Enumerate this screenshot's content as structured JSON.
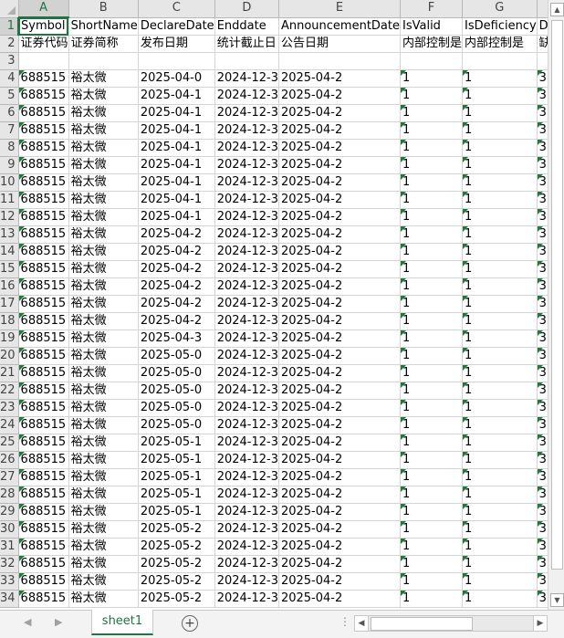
{
  "columns": [
    "A",
    "B",
    "C",
    "D",
    "E",
    "F",
    "G",
    "H"
  ],
  "header_row": [
    "Symbol",
    "ShortName",
    "DeclareDate",
    "Enddate",
    "AnnouncementDate",
    "IsValid",
    "IsDeficiency",
    "Deficiency"
  ],
  "cn_row": [
    "证券代码",
    "证券简称",
    "发布日期",
    "统计截止日",
    "公告日期",
    "内部控制是",
    "内部控制是",
    "缺陷类型"
  ],
  "data_rows": [
    [
      "688515",
      "裕太微",
      "2025-04-0",
      "2024-12-3",
      "2025-04-2",
      "1",
      "1",
      "3"
    ],
    [
      "688515",
      "裕太微",
      "2025-04-1",
      "2024-12-3",
      "2025-04-2",
      "1",
      "1",
      "3"
    ],
    [
      "688515",
      "裕太微",
      "2025-04-1",
      "2024-12-3",
      "2025-04-2",
      "1",
      "1",
      "3"
    ],
    [
      "688515",
      "裕太微",
      "2025-04-1",
      "2024-12-3",
      "2025-04-2",
      "1",
      "1",
      "3"
    ],
    [
      "688515",
      "裕太微",
      "2025-04-1",
      "2024-12-3",
      "2025-04-2",
      "1",
      "1",
      "3"
    ],
    [
      "688515",
      "裕太微",
      "2025-04-1",
      "2024-12-3",
      "2025-04-2",
      "1",
      "1",
      "3"
    ],
    [
      "688515",
      "裕太微",
      "2025-04-1",
      "2024-12-3",
      "2025-04-2",
      "1",
      "1",
      "3"
    ],
    [
      "688515",
      "裕太微",
      "2025-04-1",
      "2024-12-3",
      "2025-04-2",
      "1",
      "1",
      "3"
    ],
    [
      "688515",
      "裕太微",
      "2025-04-1",
      "2024-12-3",
      "2025-04-2",
      "1",
      "1",
      "3"
    ],
    [
      "688515",
      "裕太微",
      "2025-04-2",
      "2024-12-3",
      "2025-04-2",
      "1",
      "1",
      "3"
    ],
    [
      "688515",
      "裕太微",
      "2025-04-2",
      "2024-12-3",
      "2025-04-2",
      "1",
      "1",
      "3"
    ],
    [
      "688515",
      "裕太微",
      "2025-04-2",
      "2024-12-3",
      "2025-04-2",
      "1",
      "1",
      "3"
    ],
    [
      "688515",
      "裕太微",
      "2025-04-2",
      "2024-12-3",
      "2025-04-2",
      "1",
      "1",
      "3"
    ],
    [
      "688515",
      "裕太微",
      "2025-04-2",
      "2024-12-3",
      "2025-04-2",
      "1",
      "1",
      "3"
    ],
    [
      "688515",
      "裕太微",
      "2025-04-2",
      "2024-12-3",
      "2025-04-2",
      "1",
      "1",
      "3"
    ],
    [
      "688515",
      "裕太微",
      "2025-04-3",
      "2024-12-3",
      "2025-04-2",
      "1",
      "1",
      "3"
    ],
    [
      "688515",
      "裕太微",
      "2025-05-0",
      "2024-12-3",
      "2025-04-2",
      "1",
      "1",
      "3"
    ],
    [
      "688515",
      "裕太微",
      "2025-05-0",
      "2024-12-3",
      "2025-04-2",
      "1",
      "1",
      "3"
    ],
    [
      "688515",
      "裕太微",
      "2025-05-0",
      "2024-12-3",
      "2025-04-2",
      "1",
      "1",
      "3"
    ],
    [
      "688515",
      "裕太微",
      "2025-05-0",
      "2024-12-3",
      "2025-04-2",
      "1",
      "1",
      "3"
    ],
    [
      "688515",
      "裕太微",
      "2025-05-0",
      "2024-12-3",
      "2025-04-2",
      "1",
      "1",
      "3"
    ],
    [
      "688515",
      "裕太微",
      "2025-05-1",
      "2024-12-3",
      "2025-04-2",
      "1",
      "1",
      "3"
    ],
    [
      "688515",
      "裕太微",
      "2025-05-1",
      "2024-12-3",
      "2025-04-2",
      "1",
      "1",
      "3"
    ],
    [
      "688515",
      "裕太微",
      "2025-05-1",
      "2024-12-3",
      "2025-04-2",
      "1",
      "1",
      "3"
    ],
    [
      "688515",
      "裕太微",
      "2025-05-1",
      "2024-12-3",
      "2025-04-2",
      "1",
      "1",
      "3"
    ],
    [
      "688515",
      "裕太微",
      "2025-05-1",
      "2024-12-3",
      "2025-04-2",
      "1",
      "1",
      "3"
    ],
    [
      "688515",
      "裕太微",
      "2025-05-2",
      "2024-12-3",
      "2025-04-2",
      "1",
      "1",
      "3"
    ],
    [
      "688515",
      "裕太微",
      "2025-05-2",
      "2024-12-3",
      "2025-04-2",
      "1",
      "1",
      "3"
    ],
    [
      "688515",
      "裕太微",
      "2025-05-2",
      "2024-12-3",
      "2025-04-2",
      "1",
      "1",
      "3"
    ],
    [
      "688515",
      "裕太微",
      "2025-05-2",
      "2024-12-3",
      "2025-04-2",
      "1",
      "1",
      "3"
    ],
    [
      "688515",
      "裕太微",
      "2025-05-2",
      "2024-12-3",
      "2025-04-2",
      "1",
      "1",
      "3"
    ]
  ],
  "sheet_tab": "sheet1",
  "icons": {
    "add_sheet": "plus-circle-icon",
    "nav_prev": "triangle-left-icon",
    "nav_next": "triangle-right-icon",
    "scroll_up": "triangle-up-icon",
    "scroll_down": "triangle-down-icon",
    "more": "ellipsis-icon"
  },
  "glyphs": {
    "nav_prev": "◀",
    "nav_next": "▶",
    "scroll_up": "▲",
    "scroll_down": "▼",
    "add_sheet": "+",
    "more": "⋮",
    "h_left": "◀",
    "h_right": "▶"
  },
  "colors": {
    "accent": "#217346",
    "error_triangle": "#1f7a3a"
  }
}
